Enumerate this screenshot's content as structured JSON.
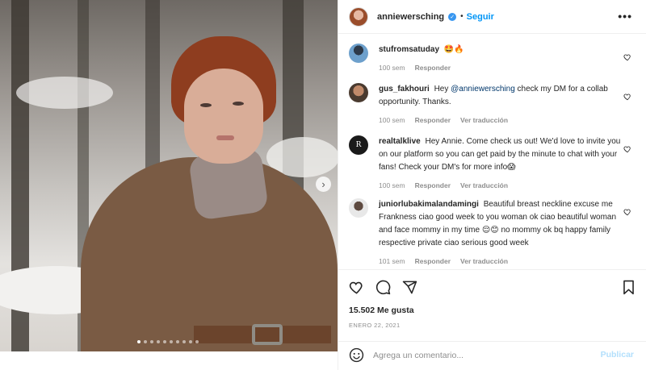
{
  "header": {
    "username": "anniewersching",
    "separator": "•",
    "follow_label": "Seguir",
    "more_label": "•••"
  },
  "carousel": {
    "next_label": "›",
    "dot_count": 10,
    "active_dot": 1
  },
  "comments": [
    {
      "user": "stufromsatuday",
      "text": "🤩🔥",
      "time": "100 sem",
      "reply": "Responder",
      "translate": ""
    },
    {
      "user": "gus_fakhouri",
      "text_before": "Hey ",
      "mention": "@anniewersching",
      "text_after": " check my DM for a collab opportunity. Thanks.",
      "time": "100 sem",
      "reply": "Responder",
      "translate": "Ver traducción"
    },
    {
      "user": "realtalklive",
      "text": "Hey Annie. Come check us out! We'd love to invite you on our platform so you can get paid by the minute to chat with your fans! Check your DM's for more info😱",
      "time": "100 sem",
      "reply": "Responder",
      "translate": "Ver traducción",
      "avatar_letter": "R"
    },
    {
      "user": "juniorlubakimalandamingi",
      "text": "Beautiful breast neckline excuse me Frankness ciao good week to you woman ok ciao beautiful woman and face mommy in my time 😌😊 no mommy ok bq happy family respective private ciao serious good week",
      "time": "101 sem",
      "reply": "Responder",
      "translate": "Ver traducción"
    }
  ],
  "actions": {
    "likes": "15.502 Me gusta",
    "date": "ENERO 22, 2021"
  },
  "composer": {
    "placeholder": "Agrega un comentario...",
    "publish_label": "Publicar"
  },
  "colors": {
    "accent": "#0095f6",
    "verified": "#3897f0",
    "publish_disabled": "#b2dffc",
    "muted": "#8e8e8e",
    "text": "#262626"
  },
  "icons": {
    "header": [
      "verified-badge-icon",
      "more-icon"
    ],
    "actions": [
      "heart-icon",
      "comment-icon",
      "share-icon",
      "bookmark-icon"
    ],
    "composer": [
      "emoji-icon"
    ]
  }
}
